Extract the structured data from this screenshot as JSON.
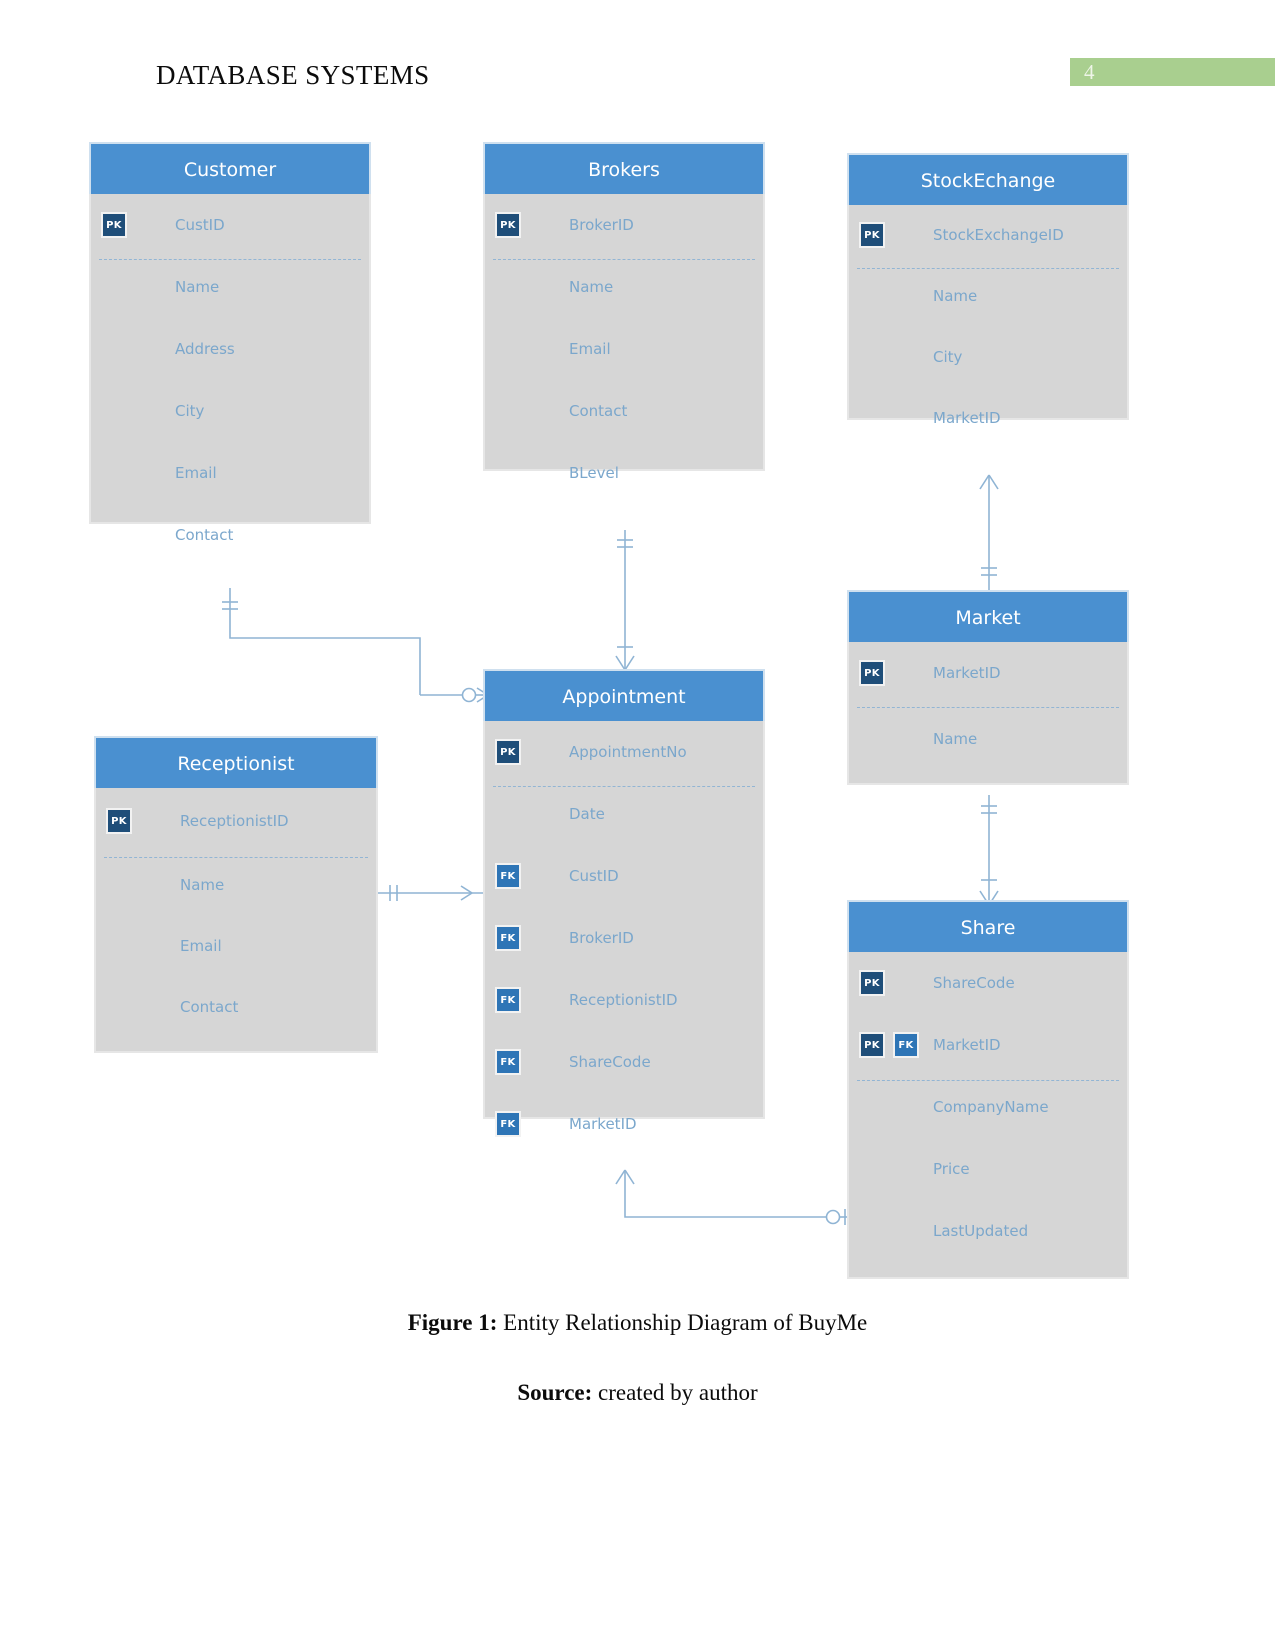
{
  "header": {
    "title": "DATABASE SYSTEMS",
    "page_number": "4",
    "badge_color": "#a9cf8f"
  },
  "colors": {
    "entity_header": "#4a90d0",
    "entity_body": "#d6d6d6",
    "attribute_text": "#7ba7cc",
    "pk_badge": "#1f4e79",
    "fk_badge": "#2e75b6",
    "connector": "#8fb4d4"
  },
  "diagram": {
    "entities": [
      {
        "name": "Customer",
        "key_attributes": [
          {
            "badges": [
              "PK"
            ],
            "label": "CustID"
          }
        ],
        "attributes": [
          {
            "badges": [],
            "label": "Name"
          },
          {
            "badges": [],
            "label": "Address"
          },
          {
            "badges": [],
            "label": "City"
          },
          {
            "badges": [],
            "label": "Email"
          },
          {
            "badges": [],
            "label": "Contact"
          }
        ]
      },
      {
        "name": "Brokers",
        "key_attributes": [
          {
            "badges": [
              "PK"
            ],
            "label": "BrokerID"
          }
        ],
        "attributes": [
          {
            "badges": [],
            "label": "Name"
          },
          {
            "badges": [],
            "label": "Email"
          },
          {
            "badges": [],
            "label": "Contact"
          },
          {
            "badges": [],
            "label": "BLevel"
          }
        ]
      },
      {
        "name": "StockEchange",
        "key_attributes": [
          {
            "badges": [
              "PK"
            ],
            "label": "StockExchangeID"
          }
        ],
        "attributes": [
          {
            "badges": [],
            "label": "Name"
          },
          {
            "badges": [],
            "label": "City"
          },
          {
            "badges": [],
            "label": "MarketID"
          }
        ]
      },
      {
        "name": "Appointment",
        "key_attributes": [
          {
            "badges": [
              "PK"
            ],
            "label": "AppointmentNo"
          }
        ],
        "attributes": [
          {
            "badges": [],
            "label": "Date"
          },
          {
            "badges": [
              "FK"
            ],
            "label": "CustID"
          },
          {
            "badges": [
              "FK"
            ],
            "label": "BrokerID"
          },
          {
            "badges": [
              "FK"
            ],
            "label": "ReceptionistID"
          },
          {
            "badges": [
              "FK"
            ],
            "label": "ShareCode"
          },
          {
            "badges": [
              "FK"
            ],
            "label": "MarketID"
          }
        ]
      },
      {
        "name": "Receptionist",
        "key_attributes": [
          {
            "badges": [
              "PK"
            ],
            "label": "ReceptionistID"
          }
        ],
        "attributes": [
          {
            "badges": [],
            "label": "Name"
          },
          {
            "badges": [],
            "label": "Email"
          },
          {
            "badges": [],
            "label": "Contact"
          }
        ]
      },
      {
        "name": "Market",
        "key_attributes": [
          {
            "badges": [
              "PK"
            ],
            "label": "MarketID"
          }
        ],
        "attributes": [
          {
            "badges": [],
            "label": "Name"
          }
        ]
      },
      {
        "name": "Share",
        "key_attributes": [
          {
            "badges": [
              "PK"
            ],
            "label": "ShareCode"
          },
          {
            "badges": [
              "PK",
              "FK"
            ],
            "label": "MarketID"
          }
        ],
        "attributes": [
          {
            "badges": [],
            "label": "CompanyName"
          },
          {
            "badges": [],
            "label": "Price"
          },
          {
            "badges": [],
            "label": "LastUpdated"
          }
        ]
      }
    ],
    "relationships": [
      {
        "from": "Customer",
        "to": "Appointment",
        "from_cardinality": "one-and-only-one",
        "to_cardinality": "zero-or-many"
      },
      {
        "from": "Brokers",
        "to": "Appointment",
        "from_cardinality": "one-and-only-one",
        "to_cardinality": "one-or-many"
      },
      {
        "from": "Receptionist",
        "to": "Appointment",
        "from_cardinality": "one-and-only-one",
        "to_cardinality": "zero-or-many"
      },
      {
        "from": "StockEchange",
        "to": "Market",
        "from_cardinality": "zero-or-many",
        "to_cardinality": "one-and-only-one"
      },
      {
        "from": "Market",
        "to": "Share",
        "from_cardinality": "one-and-only-one",
        "to_cardinality": "one-or-many"
      },
      {
        "from": "Appointment",
        "to": "Share",
        "from_cardinality": "zero-or-many",
        "to_cardinality": "one-and-only-one"
      }
    ]
  },
  "caption": {
    "figure_label": "Figure 1:",
    "figure_text": " Entity Relationship Diagram of BuyMe",
    "source_label": "Source:",
    "source_text": " created by author"
  }
}
